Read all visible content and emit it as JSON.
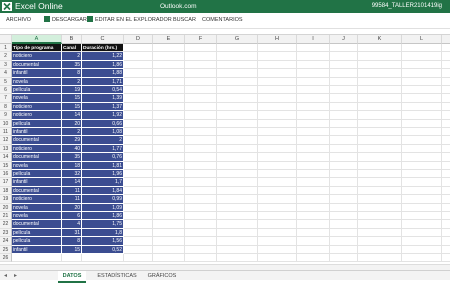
{
  "titlebar": {
    "app_name": "Excel Online",
    "service": "Outlook.com",
    "document": "99584_TALLER2101419ig"
  },
  "ribbon": {
    "items": [
      "ARCHIVO",
      "DESCARGAR",
      "EDITAR EN EL EXPLORADOR",
      "BUSCAR",
      "COMENTARIOS"
    ]
  },
  "columns": [
    "A",
    "B",
    "C",
    "D",
    "E",
    "F",
    "G",
    "H",
    "I",
    "J",
    "K",
    "L",
    "M"
  ],
  "table": {
    "headers": [
      "Tipo de programa",
      "Canal",
      "Duración (hrs.)"
    ],
    "rows": [
      [
        "noticiero",
        "2",
        "1,22"
      ],
      [
        "documental",
        "35",
        "1,86"
      ],
      [
        "infantil",
        "8",
        "1,88"
      ],
      [
        "novela",
        "2",
        "1,71"
      ],
      [
        "película",
        "19",
        "0,54"
      ],
      [
        "novela",
        "15",
        "1,39"
      ],
      [
        "noticiero",
        "15",
        "1,37"
      ],
      [
        "noticiero",
        "14",
        "1,92"
      ],
      [
        "película",
        "20",
        "0,66"
      ],
      [
        "infantil",
        "2",
        "1,08"
      ],
      [
        "documental",
        "29",
        "2"
      ],
      [
        "noticiero",
        "40",
        "1,77"
      ],
      [
        "documental",
        "35",
        "0,76"
      ],
      [
        "novela",
        "18",
        "1,81"
      ],
      [
        "película",
        "32",
        "1,96"
      ],
      [
        "infantil",
        "14",
        "1,7"
      ],
      [
        "documental",
        "11",
        "1,84"
      ],
      [
        "noticiero",
        "11",
        "0,99"
      ],
      [
        "novela",
        "20",
        "1,09"
      ],
      [
        "novela",
        "6",
        "1,86"
      ],
      [
        "documental",
        "4",
        "1,75"
      ],
      [
        "película",
        "31",
        "1,8"
      ],
      [
        "película",
        "8",
        "1,56"
      ],
      [
        "infantil",
        "15",
        "0,52"
      ]
    ]
  },
  "sheet_tabs": [
    "DATOS",
    "ESTADÍSTICAS",
    "GRÁFICOS"
  ],
  "nav": {
    "prev": "◂",
    "next": "▸"
  },
  "colors": {
    "brand": "#217346",
    "data_fill": "#3b4d91",
    "header_fill": "#111111"
  }
}
